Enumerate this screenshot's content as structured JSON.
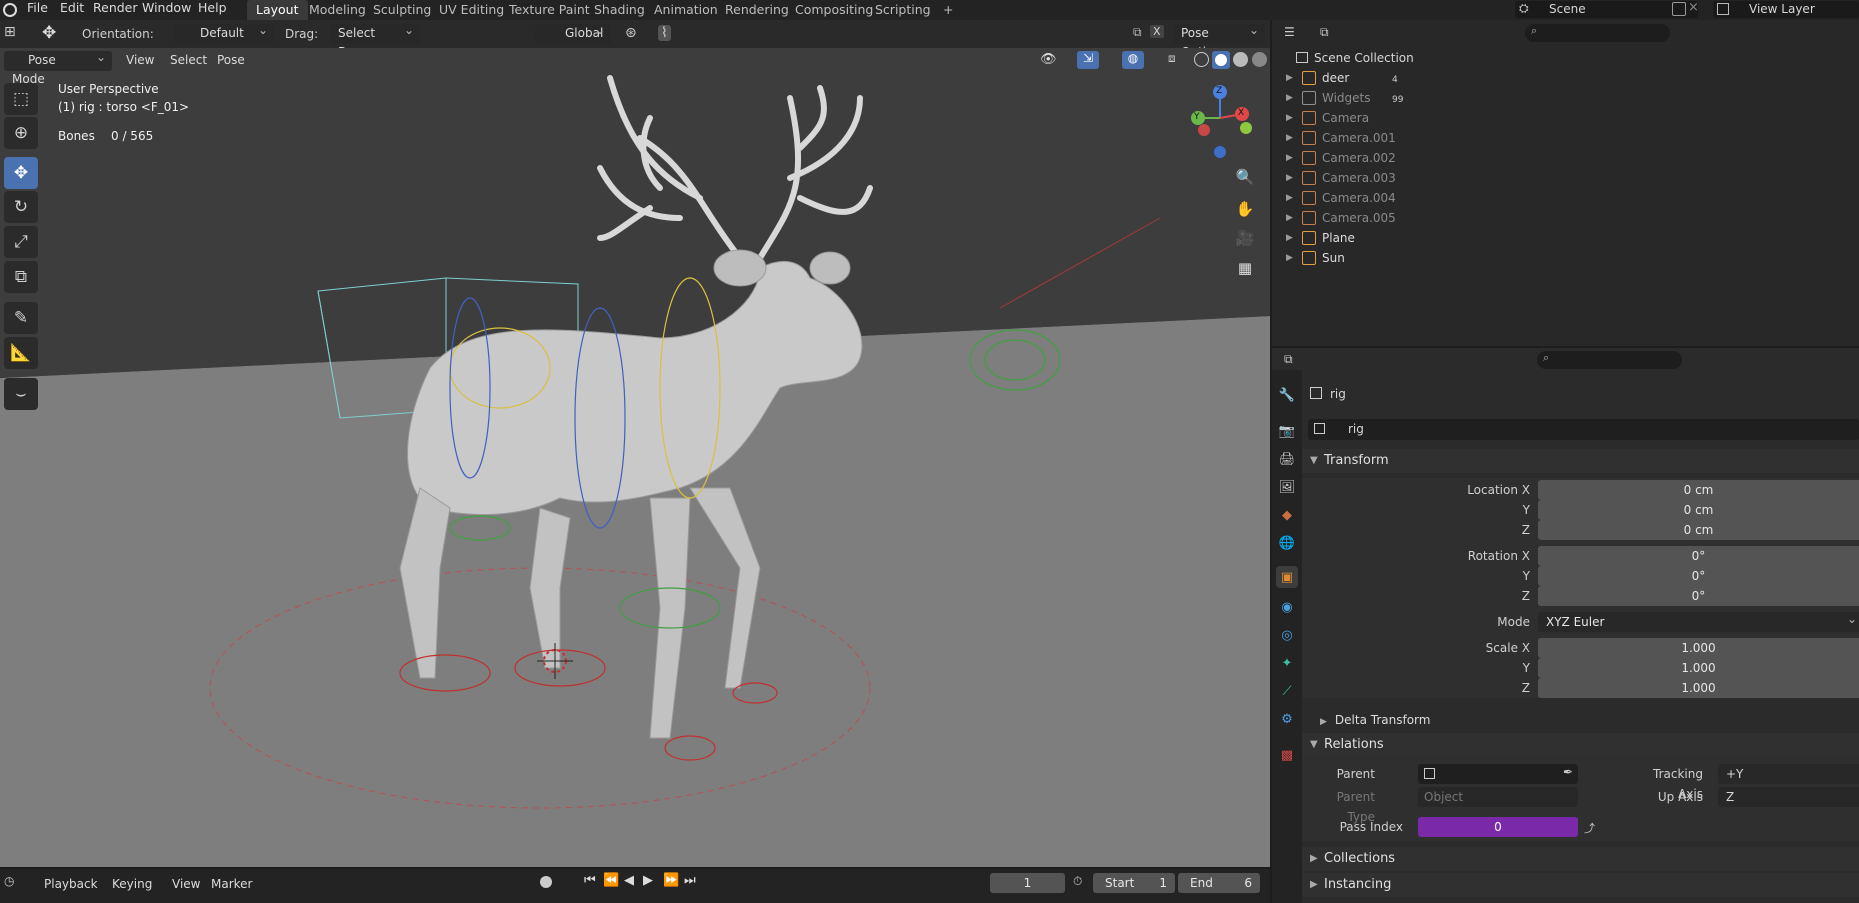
{
  "topbar": {
    "menus": [
      "File",
      "Edit",
      "Render",
      "Window",
      "Help"
    ],
    "workspaces": [
      "Layout",
      "Modeling",
      "Sculpting",
      "UV Editing",
      "Texture Paint",
      "Shading",
      "Animation",
      "Rendering",
      "Compositing",
      "Scripting"
    ],
    "active_workspace": "Layout",
    "add_tab": "+",
    "scene": "Scene",
    "view_layer": "View Layer"
  },
  "header": {
    "orientation_label": "Orientation:",
    "orientation_value": "Default",
    "drag_label": "Drag:",
    "drag_value": "Select Box",
    "transform_space": "Global",
    "pose_options": "Pose Options",
    "x_label": "X"
  },
  "viewport_header": {
    "mode": "Pose Mode",
    "menus": [
      "View",
      "Select",
      "Pose"
    ]
  },
  "viewport": {
    "perspective": "User Perspective",
    "object_info": "(1) rig : torso <F_01>",
    "bones_label": "Bones",
    "bones_value": "0 / 565",
    "gizmo": {
      "x": "X",
      "y": "Y",
      "z": "Z"
    }
  },
  "timeline": {
    "menus": [
      "Playback",
      "Keying",
      "View",
      "Marker"
    ],
    "current_frame": "1",
    "start_label": "Start",
    "start_value": "1",
    "end_label": "End",
    "end_value": "6"
  },
  "outliner": {
    "root": "Scene Collection",
    "items": [
      {
        "name": "deer",
        "icon_color": "#e0a040",
        "extra": "4",
        "enabled": true
      },
      {
        "name": "Widgets",
        "icon_color": "#909090",
        "extra": "99",
        "enabled": false
      },
      {
        "name": "Camera",
        "icon_color": "#c08050",
        "enabled": false
      },
      {
        "name": "Camera.001",
        "icon_color": "#c08050",
        "enabled": false
      },
      {
        "name": "Camera.002",
        "icon_color": "#c08050",
        "enabled": false
      },
      {
        "name": "Camera.003",
        "icon_color": "#c08050",
        "enabled": false
      },
      {
        "name": "Camera.004",
        "icon_color": "#c08050",
        "enabled": false
      },
      {
        "name": "Camera.005",
        "icon_color": "#c08050",
        "enabled": false
      },
      {
        "name": "Plane",
        "icon_color": "#e0a040",
        "enabled": true
      },
      {
        "name": "Sun",
        "icon_color": "#e0a040",
        "enabled": true
      }
    ]
  },
  "properties": {
    "object_name": "rig",
    "data_name": "rig",
    "transform": {
      "title": "Transform",
      "location_x_label": "Location X",
      "location_x": "0 cm",
      "location_y_label": "Y",
      "location_y": "0 cm",
      "location_z_label": "Z",
      "location_z": "0 cm",
      "rotation_x_label": "Rotation X",
      "rotation_x": "0°",
      "rotation_y_label": "Y",
      "rotation_y": "0°",
      "rotation_z_label": "Z",
      "rotation_z": "0°",
      "mode_label": "Mode",
      "mode": "XYZ Euler",
      "scale_x_label": "Scale X",
      "scale_x": "1.000",
      "scale_y_label": "Y",
      "scale_y": "1.000",
      "scale_z_label": "Z",
      "scale_z": "1.000"
    },
    "delta_transform": "Delta Transform",
    "relations": {
      "title": "Relations",
      "parent_label": "Parent",
      "parent_type_label": "Parent Type",
      "parent_type": "Object",
      "tracking_axis_label": "Tracking Axis",
      "tracking_axis": "+Y",
      "up_axis_label": "Up Axis",
      "up_axis": "Z",
      "pass_index_label": "Pass Index",
      "pass_index": "0"
    },
    "collections": "Collections",
    "instancing": "Instancing"
  }
}
